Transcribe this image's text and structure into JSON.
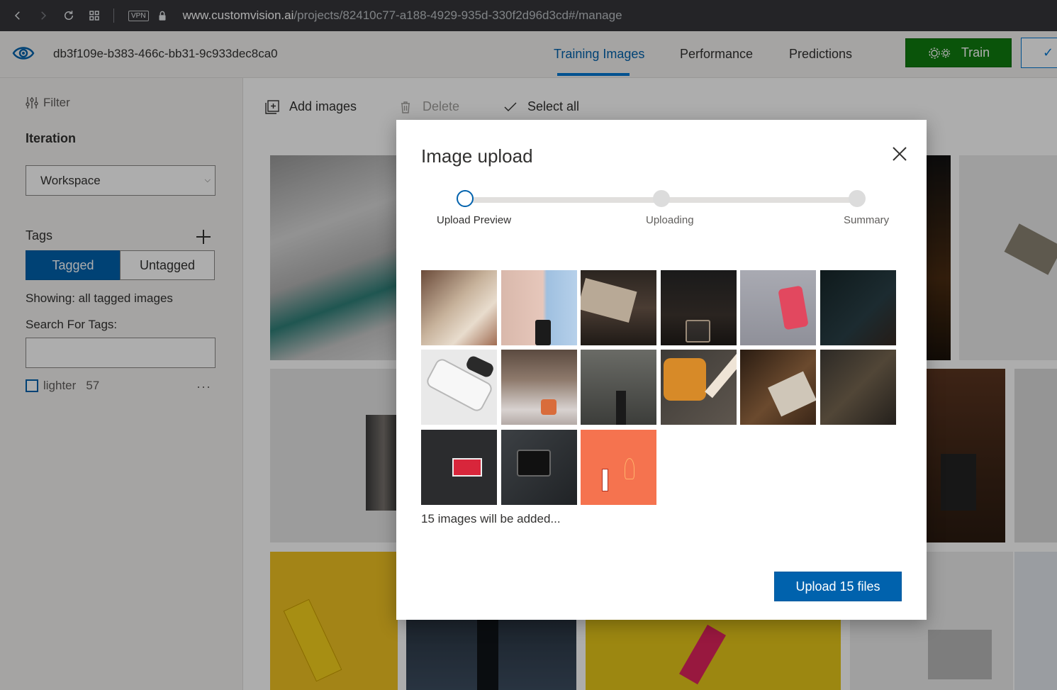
{
  "browser": {
    "vpn_label": "VPN",
    "url_host": "www.customvision.ai",
    "url_path": "/projects/82410c77-a188-4929-935d-330f2d96d3cd#/manage"
  },
  "header": {
    "project_name": "db3f109e-b383-466c-bb31-9c933dec8ca0",
    "tabs": [
      {
        "label": "Training Images",
        "active": true
      },
      {
        "label": "Performance",
        "active": false
      },
      {
        "label": "Predictions",
        "active": false
      }
    ],
    "train_label": "Train",
    "quick_test_glyph": "✓"
  },
  "sidebar": {
    "filter_label": "Filter",
    "iteration_heading": "Iteration",
    "iteration_value": "Workspace",
    "tags_heading": "Tags",
    "segment_tagged": "Tagged",
    "segment_untagged": "Untagged",
    "showing_text": "Showing: all tagged images",
    "search_label": "Search For Tags:",
    "search_value": "",
    "tag": {
      "name": "lighter",
      "count": "57"
    },
    "more_glyph": "···"
  },
  "toolbar": {
    "add_images": "Add images",
    "delete": "Delete",
    "select_all": "Select all"
  },
  "dialog": {
    "title": "Image upload",
    "steps": [
      {
        "label": "Upload Preview",
        "state": "current"
      },
      {
        "label": "Uploading",
        "state": "pending"
      },
      {
        "label": "Summary",
        "state": "pending"
      }
    ],
    "images_added_text": "15 images will be added...",
    "upload_button": "Upload 15 files"
  },
  "colors": {
    "accent": "#0062ad",
    "train_green": "#107c10",
    "chrome_bg": "#35363a",
    "panel_bg": "#f3f2f1"
  }
}
